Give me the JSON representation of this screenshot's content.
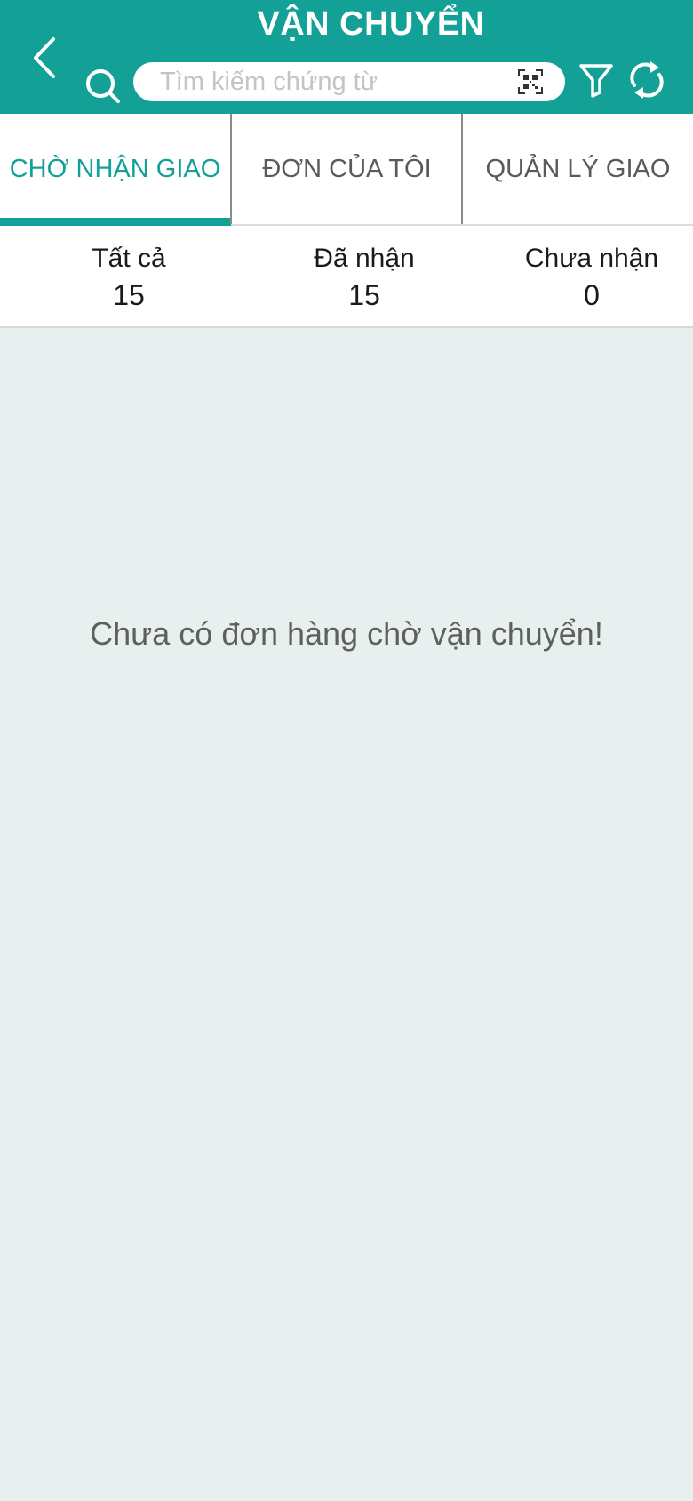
{
  "header": {
    "title": "VẬN CHUYỂN",
    "search_placeholder": "Tìm kiếm chứng từ",
    "search_value": "",
    "icons": [
      "back-icon",
      "search-icon",
      "qr-scan-icon",
      "filter-icon",
      "refresh-icon"
    ],
    "background_color": "#12a097"
  },
  "tabs": [
    {
      "label": "CHỜ NHẬN GIAO",
      "active": true
    },
    {
      "label": "ĐƠN CỦA TÔI",
      "active": false
    },
    {
      "label": "QUẢN LÝ GIAO",
      "active": false
    }
  ],
  "stats": [
    {
      "label": "Tất cả",
      "value": "15"
    },
    {
      "label": "Đã nhận",
      "value": "15"
    },
    {
      "label": "Chưa nhận",
      "value": "0"
    }
  ],
  "empty_message": "Chưa có đơn hàng chờ vận chuyển!",
  "colors": {
    "accent": "#12a097",
    "page_background": "#e8f0ef"
  }
}
